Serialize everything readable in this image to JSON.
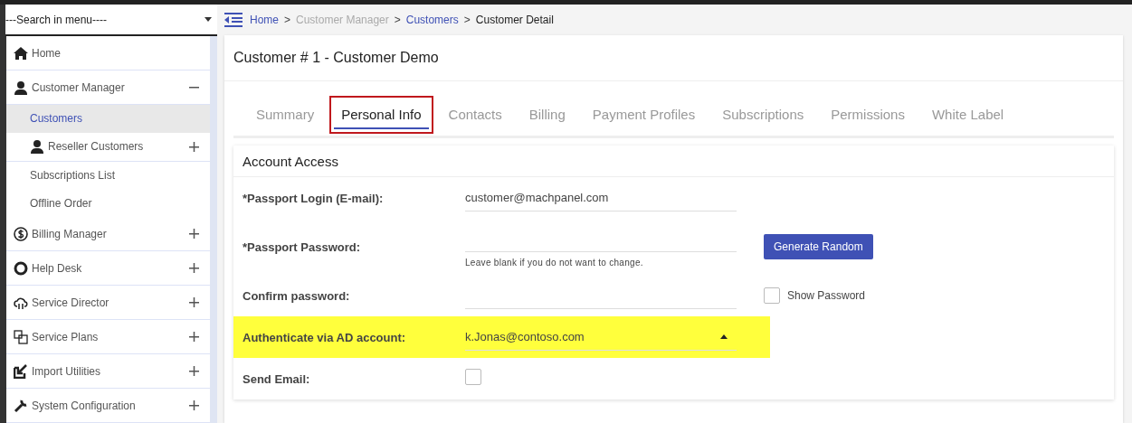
{
  "sidebar": {
    "search": {
      "placeholder": "---Search in menu----"
    },
    "items": [
      {
        "label": "Home",
        "selected": false
      },
      {
        "label": "Customer Manager",
        "expanded": true,
        "selected": false,
        "children": [
          {
            "label": "Customers",
            "selected": true
          },
          {
            "label": "Reseller Customers",
            "expanded": false,
            "selected": false
          },
          {
            "label": "Subscriptions List",
            "selected": false
          },
          {
            "label": "Offline Order",
            "selected": false
          }
        ]
      },
      {
        "label": "Billing Manager",
        "expanded": false,
        "selected": false
      },
      {
        "label": "Help Desk",
        "expanded": false,
        "selected": false
      },
      {
        "label": "Service Director",
        "expanded": false,
        "selected": false
      },
      {
        "label": "Service Plans",
        "expanded": false,
        "selected": false
      },
      {
        "label": "Import Utilities",
        "expanded": false,
        "selected": false
      },
      {
        "label": "System Configuration",
        "expanded": false,
        "selected": false
      }
    ]
  },
  "breadcrumb": [
    {
      "label": "Home",
      "kind": "link"
    },
    {
      "label": ">",
      "kind": "separator"
    },
    {
      "label": "Customer Manager",
      "kind": "muted"
    },
    {
      "label": ">",
      "kind": "separator"
    },
    {
      "label": "Customers",
      "kind": "link"
    },
    {
      "label": ">",
      "kind": "separator"
    },
    {
      "label": "Customer Detail",
      "kind": "current"
    }
  ],
  "page_title": "Customer # 1 - Customer Demo",
  "tabs": [
    {
      "label": "Summary",
      "selected": false,
      "highlighted": false
    },
    {
      "label": "Personal Info",
      "selected": true,
      "highlighted": true
    },
    {
      "label": "Contacts",
      "selected": false,
      "highlighted": false
    },
    {
      "label": "Billing",
      "selected": false,
      "highlighted": false
    },
    {
      "label": "Payment Profiles",
      "selected": false,
      "highlighted": false
    },
    {
      "label": "Subscriptions",
      "selected": false,
      "highlighted": false
    },
    {
      "label": "Permissions",
      "selected": false,
      "highlighted": false
    },
    {
      "label": "White Label",
      "selected": false,
      "highlighted": false
    }
  ],
  "section": {
    "title": "Account Access",
    "rows": [
      {
        "label": "*Passport Login (E-mail):",
        "kind": "text",
        "value": "customer@machpanel.com",
        "highlighted": false
      },
      {
        "label": "*Passport Password:",
        "kind": "password",
        "hint": "Leave blank if you do not want to change.",
        "button": "Generate Random",
        "highlighted": false
      },
      {
        "label": "Confirm password:",
        "kind": "confirm",
        "checkbox_label": "Show Password",
        "checked": false,
        "highlighted": false
      },
      {
        "label": "Authenticate via AD account:",
        "kind": "select",
        "value": "k.Jonas@contoso.com",
        "highlighted": true
      },
      {
        "label": "Send Email:",
        "kind": "checkbox",
        "checked": false,
        "highlighted": false
      }
    ]
  }
}
